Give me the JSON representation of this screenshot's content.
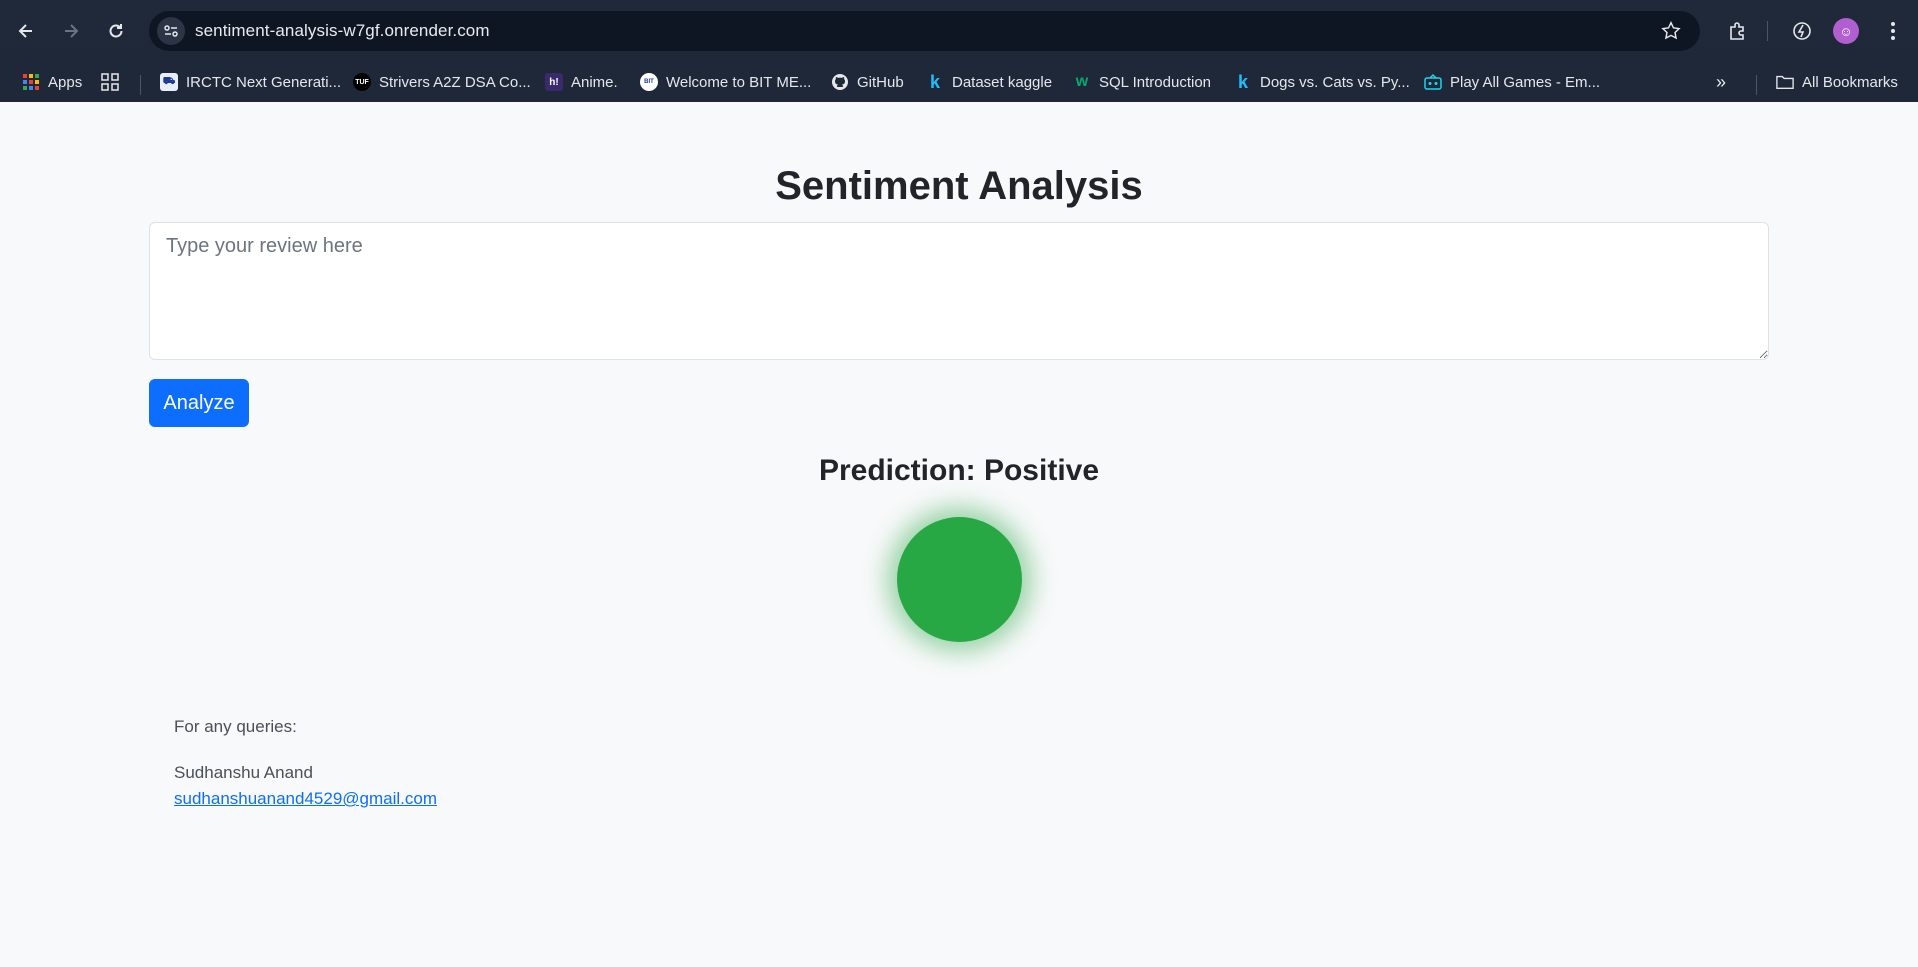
{
  "browser": {
    "url": "sentiment-analysis-w7gf.onrender.com",
    "bookmarks": [
      {
        "label": "Apps",
        "icon": "apps-grid-icon"
      },
      {
        "label": "IRCTC Next Generati...",
        "icon": "irctc-icon"
      },
      {
        "label": "Strivers A2Z DSA Co...",
        "icon": "tuf-icon",
        "icon_text": "TUF"
      },
      {
        "label": "Anime.",
        "icon": "hianime-icon",
        "icon_text": "h!"
      },
      {
        "label": "Welcome to BIT ME...",
        "icon": "bit-icon",
        "icon_text": "BIT"
      },
      {
        "label": "GitHub",
        "icon": "github-icon"
      },
      {
        "label": "Dataset kaggle",
        "icon": "kaggle-icon",
        "icon_text": "k"
      },
      {
        "label": "SQL Introduction",
        "icon": "w3schools-icon",
        "icon_text": "w"
      },
      {
        "label": "Dogs vs. Cats vs. Py...",
        "icon": "kaggle-icon",
        "icon_text": "k"
      },
      {
        "label": "Play All Games - Em...",
        "icon": "emulator-icon"
      }
    ],
    "all_bookmarks": "All Bookmarks"
  },
  "page": {
    "title": "Sentiment Analysis",
    "review_placeholder": "Type your review here",
    "analyze_label": "Analyze",
    "prediction": "Prediction: Positive",
    "indicator_color": "#28a745",
    "footer": {
      "queries": "For any queries:",
      "name": "Sudhanshu Anand",
      "email": "sudhanshuanand4529@gmail.com"
    }
  },
  "colors": {
    "accent": "#0d6efd",
    "chrome_bg": "#1f2937"
  }
}
